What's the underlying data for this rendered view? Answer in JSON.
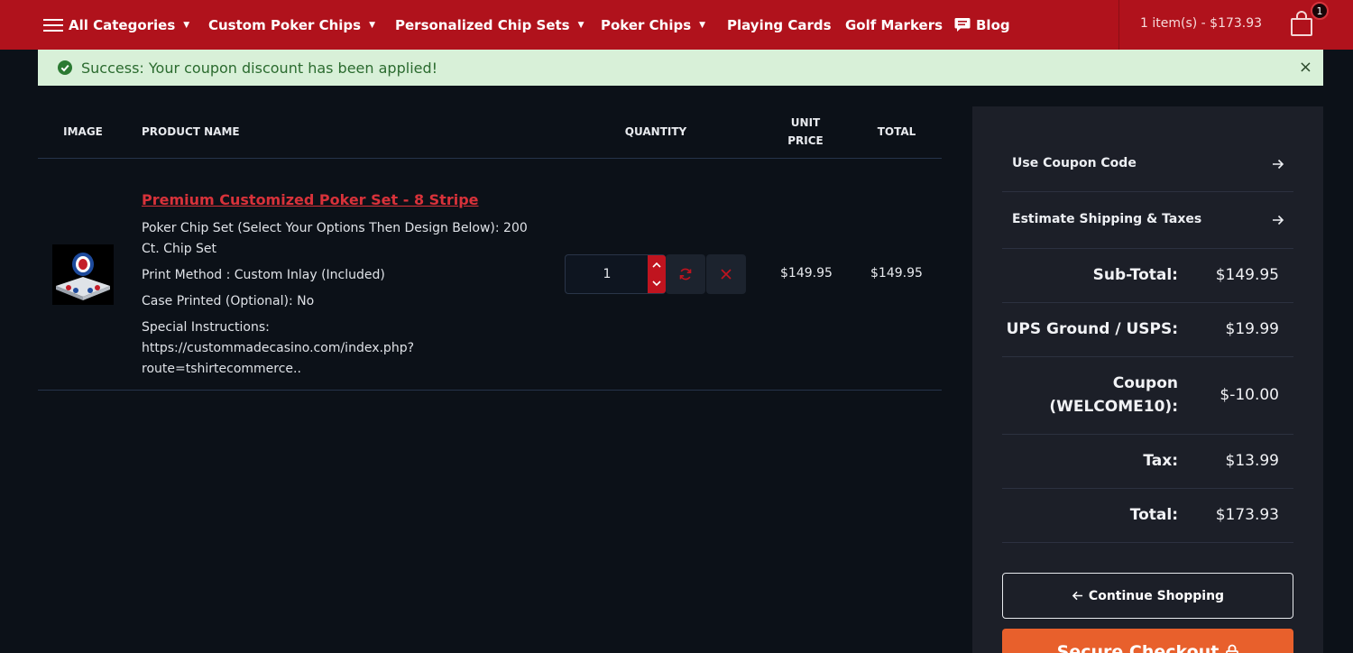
{
  "nav": {
    "all_categories": "All Categories",
    "custom_poker_chips": "Custom Poker Chips",
    "personalized_chip_sets": "Personalized Chip Sets",
    "poker_chips": "Poker Chips",
    "playing_cards": "Playing Cards",
    "golf_markers": "Golf Markers",
    "blog": "Blog",
    "cart_summary": "1 item(s) - $173.93",
    "cart_count": "1"
  },
  "alert": {
    "message": "Success: Your coupon discount has been applied!",
    "close": "×"
  },
  "table": {
    "headers": {
      "image": "IMAGE",
      "product_name": "PRODUCT NAME",
      "quantity": "QUANTITY",
      "unit_price_1": "UNIT",
      "unit_price_2": "PRICE",
      "total": "TOTAL"
    },
    "item": {
      "name": "Premium Customized Poker Set - 8 Stripe",
      "option_chip_set_1": "Poker Chip Set (Select Your Options Then Design Below): 200",
      "option_chip_set_2": "Ct. Chip Set",
      "option_print_method": "Print Method : Custom Inlay (Included)",
      "option_case_printed": "Case Printed (Optional): No",
      "option_instructions_1": "Special Instructions: https://custommadecasino.com/index.php?",
      "option_instructions_2": "route=tshirtecommerce..",
      "quantity": "1",
      "unit_price": "$149.95",
      "total": "$149.95"
    }
  },
  "sidebar": {
    "coupon_link": "Use Coupon Code",
    "shipping_link": "Estimate Shipping & Taxes",
    "subtotal_label": "Sub-Total:",
    "subtotal_value": "$149.95",
    "shipping_label": "UPS Ground / USPS:",
    "shipping_value": "$19.99",
    "coupon_label_1": "Coupon",
    "coupon_label_2": "(WELCOME10):",
    "coupon_value": "$-10.00",
    "tax_label": "Tax:",
    "tax_value": "$13.99",
    "total_label": "Total:",
    "total_value": "$173.93",
    "continue_button": "Continue Shopping",
    "checkout_button": "Secure Checkout"
  },
  "colors": {
    "nav_bg": "#b0121c",
    "page_bg": "#0c1118",
    "sidebar_bg": "#1c1f28",
    "alert_bg": "#d8f0d8",
    "link_red": "#d8323a",
    "checkout_orange": "#e8602c"
  },
  "icons": {
    "menu": "hamburger-icon",
    "blog": "comment-icon",
    "cart": "shopping-bag-icon",
    "alert": "check-circle-icon",
    "refresh": "refresh-icon",
    "remove": "close-icon",
    "arrow": "arrow-right-icon",
    "back": "arrow-left-icon",
    "lock": "lock-icon"
  }
}
